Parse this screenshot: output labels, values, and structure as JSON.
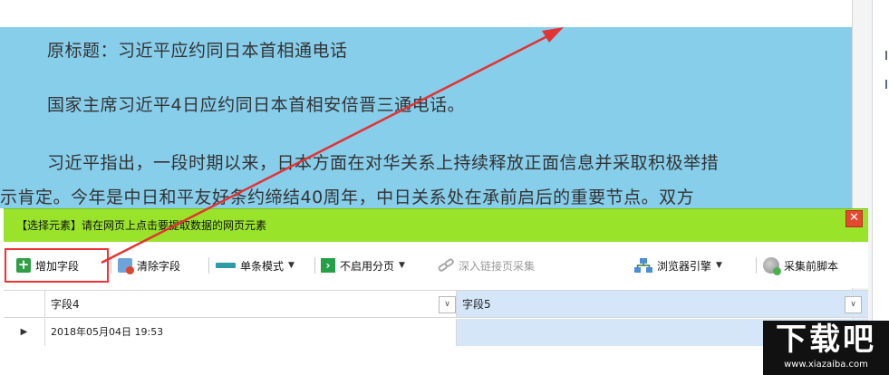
{
  "article": {
    "p1": "原标题：习近平应约同日本首相通电话",
    "p2": "国家主席习近平4日应约同日本首相安倍晋三通电话。",
    "p3": "习近平指出，一段时期以来，日本方面在对华关系上持续释放正面信息并采取积极举措",
    "p4": "示肯定。今年是中日和平友好条约缔结40周年，中日关系处在承前启后的重要节点。双方"
  },
  "select_bar": {
    "hint": "【选择元素】请在网页上点击要提取数据的网页元素",
    "close": "✕"
  },
  "toolbar": {
    "add_field": "增加字段",
    "clear_field": "清除字段",
    "single_mode": "单条模式",
    "no_paging": "不启用分页",
    "deep_link": "深入链接页采集",
    "browser_engine": "浏览器引擎",
    "pre_script": "采集前脚本",
    "caret": "▼"
  },
  "grid": {
    "columns": [
      "字段4",
      "字段5"
    ],
    "dropdown_glyph": "∨",
    "rows": [
      {
        "marker": "▶",
        "cells": [
          "2018年05月04日 19:53",
          ""
        ]
      }
    ]
  },
  "watermark": {
    "main": "下载吧",
    "sub": "www.xiazaiba.com"
  },
  "colors": {
    "article_highlight": "#87ceeb",
    "select_bar": "#99e32b",
    "annotation_red": "#e33333",
    "column_selected": "#d4e6f7"
  }
}
